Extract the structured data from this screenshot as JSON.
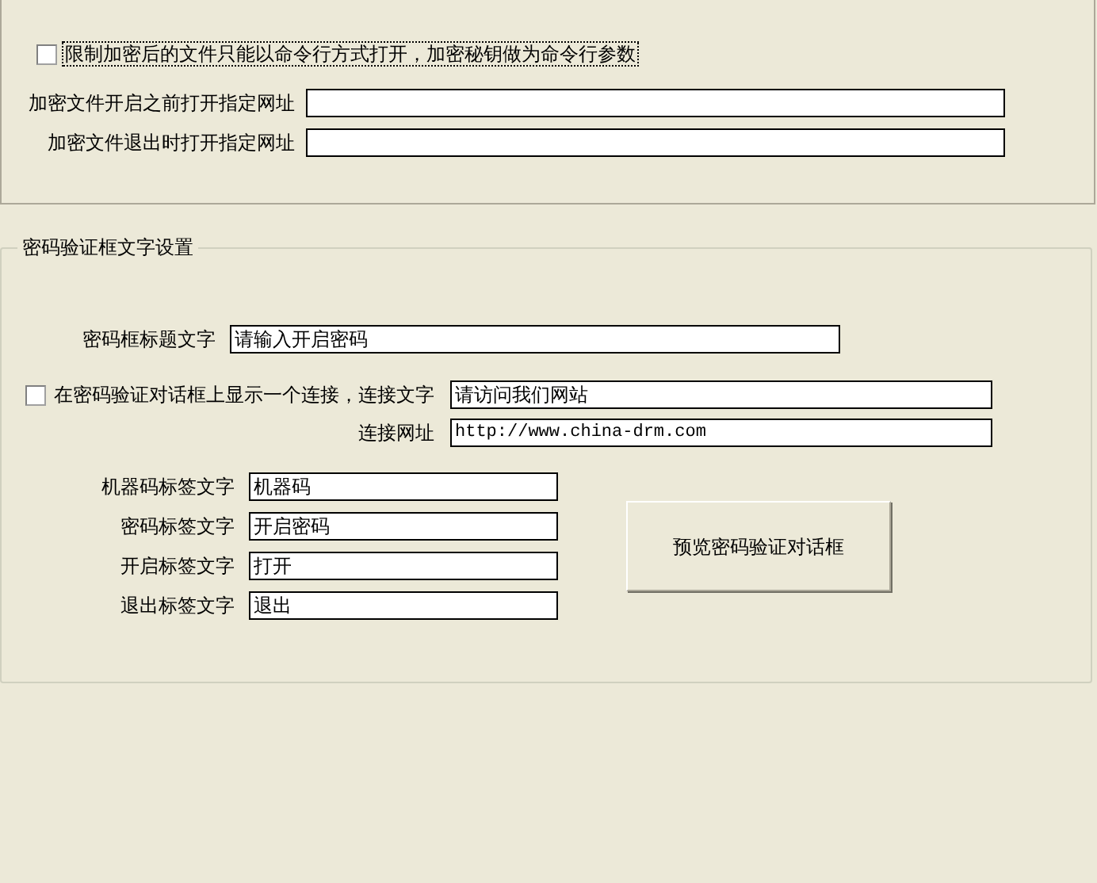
{
  "restrict_option": {
    "label": "限制加密后的文件只能以命令行方式打开，加密秘钥做为命令行参数",
    "checked": false
  },
  "url_fields": [
    {
      "label": "加密文件开启之前打开指定网址"
    },
    {
      "label": "加密文件退出时打开指定网址"
    }
  ],
  "password_dialog_group": {
    "title": "密码验证框文字设置",
    "title_field": {
      "label": "密码框标题文字",
      "value": "请输入开启密码"
    },
    "link_option": {
      "label": "在密码验证对话框上显示一个连接，连接文字",
      "checked": false,
      "value": "请访问我们网站"
    },
    "link_url": {
      "label": "连接网址",
      "value": "http://www.china-drm.com"
    },
    "label_fields": [
      {
        "label": "机器码标签文字",
        "value": "机器码"
      },
      {
        "label": "密码标签文字",
        "value": "开启密码"
      },
      {
        "label": "开启标签文字",
        "value": "打开"
      },
      {
        "label": "退出标签文字",
        "value": "退出"
      }
    ],
    "preview_button": "预览密码验证对话框"
  }
}
